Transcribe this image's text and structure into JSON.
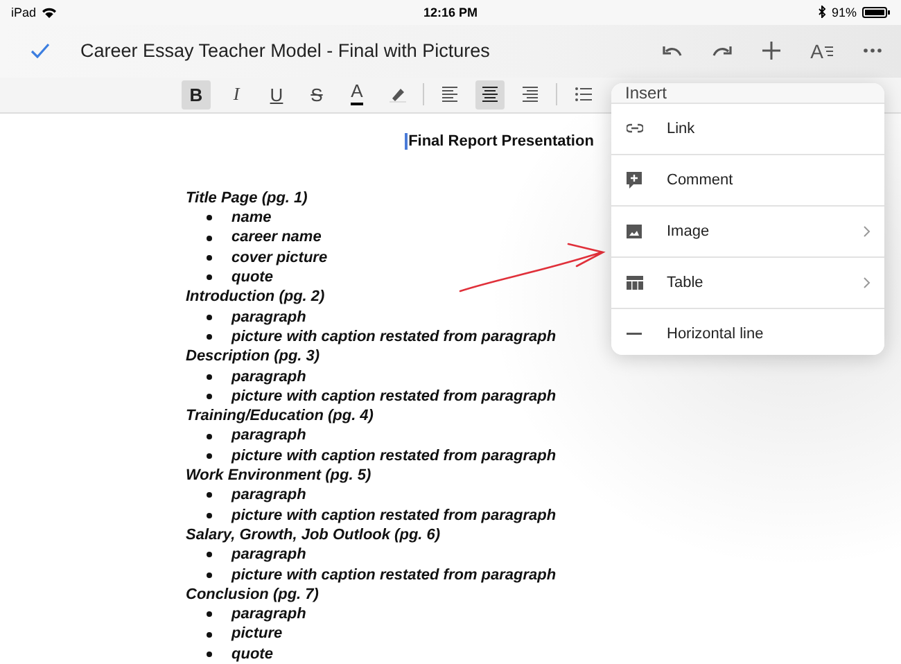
{
  "status_bar": {
    "device": "iPad",
    "time": "12:16 PM",
    "battery": "91%"
  },
  "title_bar": {
    "title": "Career Essay Teacher Model - Final with Pictures",
    "format_label": "A"
  },
  "toolbar": [
    {
      "kind": "bold",
      "label": "B",
      "selected": true
    },
    {
      "kind": "italic",
      "label": "I",
      "selected": false
    },
    {
      "kind": "underline",
      "label": "U",
      "selected": false
    },
    {
      "kind": "strike",
      "label": "S",
      "selected": false
    },
    {
      "kind": "color",
      "label": "A",
      "selected": false
    },
    {
      "kind": "highlight",
      "selected": false
    },
    {
      "kind": "divider"
    },
    {
      "kind": "align-left",
      "selected": false
    },
    {
      "kind": "align-center",
      "selected": true
    },
    {
      "kind": "align-right",
      "selected": false
    },
    {
      "kind": "divider"
    },
    {
      "kind": "list",
      "selected": false
    }
  ],
  "document": {
    "heading": "Final Report Presentation",
    "sections": [
      {
        "heading": "Title Page (pg. 1)",
        "items": [
          "name",
          "career name",
          "cover picture",
          "quote"
        ]
      },
      {
        "heading": "Introduction (pg. 2)",
        "items": [
          "paragraph",
          "picture with caption restated from paragraph"
        ]
      },
      {
        "heading": "Description (pg. 3)",
        "items": [
          "paragraph",
          "picture with caption restated from paragraph"
        ]
      },
      {
        "heading": "Training/Education (pg. 4)",
        "items": [
          "paragraph",
          "picture with caption restated from paragraph"
        ]
      },
      {
        "heading": "Work Environment (pg. 5)",
        "items": [
          "paragraph",
          "picture with caption restated from paragraph"
        ]
      },
      {
        "heading": "Salary, Growth, Job Outlook (pg. 6)",
        "items": [
          "paragraph",
          "picture with caption restated from paragraph"
        ]
      },
      {
        "heading": "Conclusion (pg. 7)",
        "items": [
          "paragraph",
          "picture",
          "quote"
        ]
      }
    ]
  },
  "insert_menu": {
    "title": "Insert",
    "items": [
      {
        "kind": "link",
        "label": "Link",
        "submenu": false
      },
      {
        "kind": "comment",
        "label": "Comment",
        "submenu": false
      },
      {
        "kind": "image",
        "label": "Image",
        "submenu": true
      },
      {
        "kind": "table",
        "label": "Table",
        "submenu": true
      },
      {
        "kind": "rule",
        "label": "Horizontal line",
        "submenu": false
      }
    ]
  }
}
